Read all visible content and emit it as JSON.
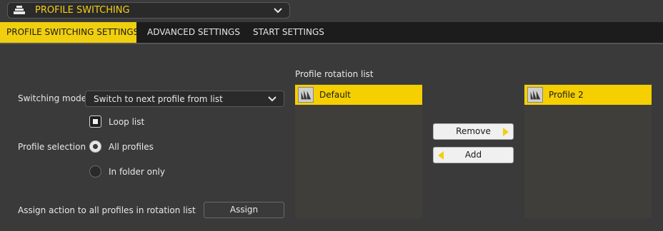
{
  "mode_dropdown": {
    "label": "PROFILE SWITCHING",
    "icon": "menu-stack-icon",
    "accent": "#f4d018"
  },
  "tabs": [
    {
      "label": "PROFILE SWITCHING SETTINGS",
      "active": true
    },
    {
      "label": "ADVANCED SETTINGS",
      "active": false
    },
    {
      "label": "START SETTINGS",
      "active": false
    }
  ],
  "settings": {
    "switching_mode_label": "Switching mode",
    "switching_mode_value": "Switch to next profile from list",
    "loop_list_label": "Loop list",
    "loop_list_checked": true,
    "profile_selection_label": "Profile selection",
    "profile_selection_options": [
      {
        "label": "All profiles",
        "checked": true
      },
      {
        "label": "In folder only",
        "checked": false
      }
    ],
    "assign_label": "Assign action to all profiles in rotation list",
    "assign_button": "Assign"
  },
  "rotation": {
    "title": "Profile rotation list",
    "left_items": [
      {
        "name": "Default",
        "icon": "corsair-sails-icon"
      }
    ],
    "right_items": [
      {
        "name": "Profile 2",
        "icon": "corsair-sails-icon"
      }
    ],
    "remove_button": "Remove",
    "add_button": "Add"
  },
  "colors": {
    "accent": "#f0cf0e",
    "list_highlight": "#f5cf00",
    "panel": "#3a3a3a"
  }
}
